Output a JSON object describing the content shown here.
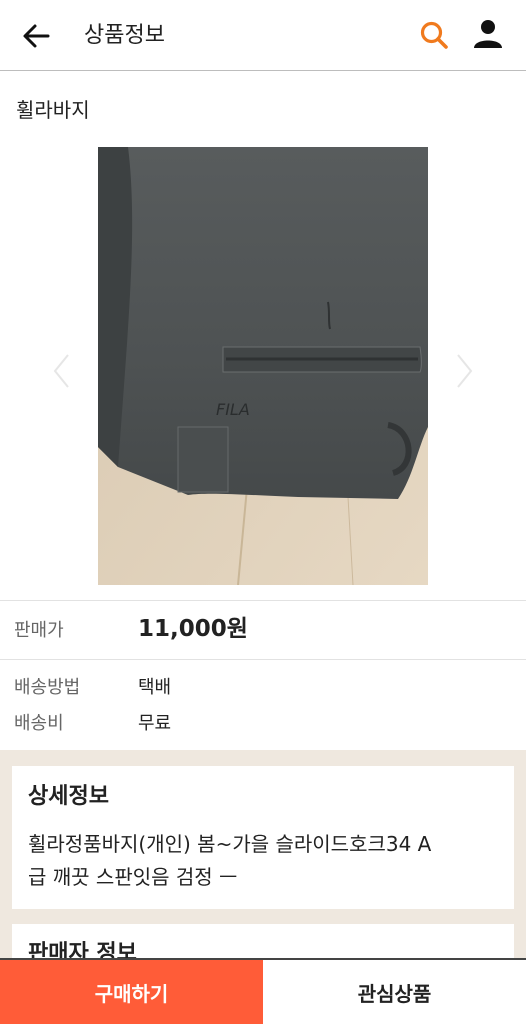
{
  "header": {
    "title": "상품정보",
    "accent_color": "#f07a1e"
  },
  "product": {
    "name": "휠라바지",
    "image_count": 5,
    "active_image": 3
  },
  "info": {
    "price_label": "판매가",
    "price": "11,000원",
    "shipping_method_label": "배송방법",
    "shipping_method": "택배",
    "shipping_fee_label": "배송비",
    "shipping_fee": "무료"
  },
  "detail": {
    "title": "상세정보",
    "text_line1": "휠라정품바지(개인) 봄~가을 슬라이드호크34 A",
    "text_line2": "급 깨끗 스판잇음 검정 ㅡ"
  },
  "seller": {
    "title": "판매자 정보"
  },
  "bottom": {
    "buy_label": "구매하기",
    "buy_color": "#ff5c38",
    "wishlist_label": "관심상품"
  }
}
